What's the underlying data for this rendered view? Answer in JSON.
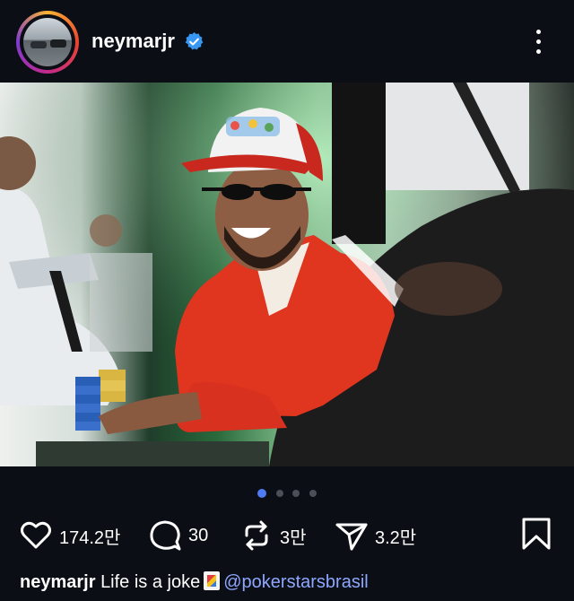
{
  "header": {
    "username": "neymarjr",
    "verified": true
  },
  "post": {
    "image_alt": "Neymar at a poker table wearing a red jacket and cap"
  },
  "carousel": {
    "count": 4,
    "active_index": 0
  },
  "actions": {
    "likes": "174.2만",
    "comments": "30",
    "reposts": "3만",
    "shares": "3.2만"
  },
  "caption": {
    "username": "neymarjr",
    "text": "Life is a joke",
    "mention": "@pokerstarsbrasil"
  },
  "colors": {
    "background": "#0b0e14",
    "verified_blue": "#3897f0",
    "mention": "#8ea7ff",
    "dot_active": "#4f7cf2"
  }
}
